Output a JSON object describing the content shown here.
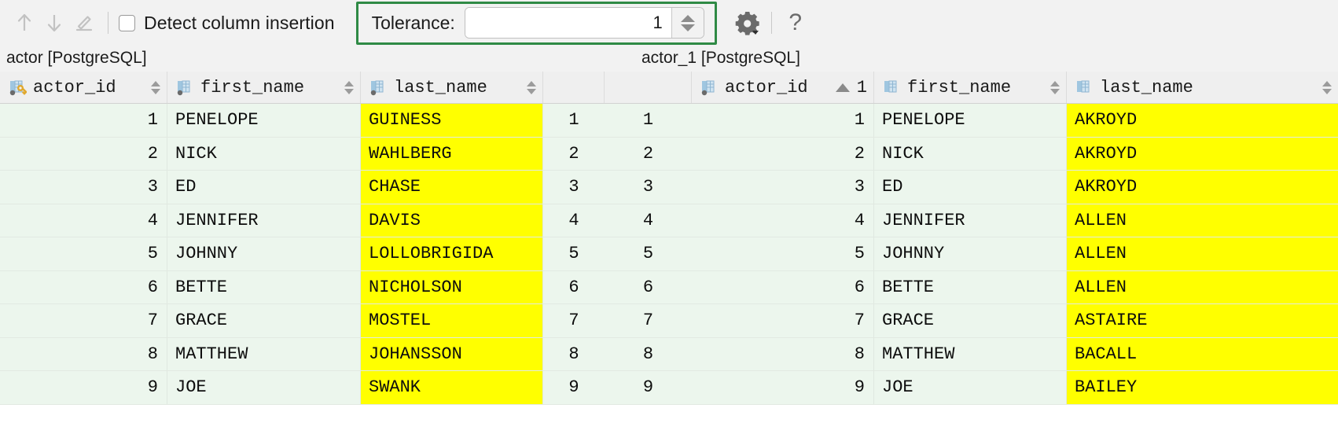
{
  "toolbar": {
    "icons": [
      {
        "name": "previous-difference-icon",
        "glyph": "up-arrow"
      },
      {
        "name": "next-difference-icon",
        "glyph": "down-arrow"
      },
      {
        "name": "edit-icon",
        "glyph": "pencil"
      }
    ],
    "detect_column_insertion_label": "Detect column insertion",
    "detect_column_insertion_checked": false,
    "tolerance_label": "Tolerance:",
    "tolerance_value": "1",
    "tolerance_placeholder": "",
    "settings_icon": "gear-icon",
    "help_icon": "question-mark-icon",
    "highlight_color": "#2f8a45"
  },
  "left_table": {
    "title": "actor [PostgreSQL]",
    "columns": [
      {
        "label": "actor_id",
        "icon": "primary-key-column-icon",
        "sortable": true
      },
      {
        "label": "first_name",
        "icon": "column-icon",
        "sortable": true
      },
      {
        "label": "last_name",
        "icon": "column-icon",
        "sortable": true
      }
    ],
    "rows": [
      {
        "actor_id": "1",
        "first_name": "PENELOPE",
        "last_name": "GUINESS"
      },
      {
        "actor_id": "2",
        "first_name": "NICK",
        "last_name": "WAHLBERG"
      },
      {
        "actor_id": "3",
        "first_name": "ED",
        "last_name": "CHASE"
      },
      {
        "actor_id": "4",
        "first_name": "JENNIFER",
        "last_name": "DAVIS"
      },
      {
        "actor_id": "5",
        "first_name": "JOHNNY",
        "last_name": "LOLLOBRIGIDA"
      },
      {
        "actor_id": "6",
        "first_name": "BETTE",
        "last_name": "NICHOLSON"
      },
      {
        "actor_id": "7",
        "first_name": "GRACE",
        "last_name": "MOSTEL"
      },
      {
        "actor_id": "8",
        "first_name": "MATTHEW",
        "last_name": "JOHANSSON"
      },
      {
        "actor_id": "9",
        "first_name": "JOE",
        "last_name": "SWANK"
      }
    ]
  },
  "gutter_left": {
    "values": [
      "1",
      "2",
      "3",
      "4",
      "5",
      "6",
      "7",
      "8",
      "9"
    ]
  },
  "gutter_right": {
    "values": [
      "1",
      "2",
      "3",
      "4",
      "5",
      "6",
      "7",
      "8",
      "9"
    ]
  },
  "right_table": {
    "title": "actor_1 [PostgreSQL]",
    "columns": [
      {
        "label": "actor_id",
        "icon": "column-icon",
        "sortable": true,
        "sort_direction": "asc",
        "sort_order": "1"
      },
      {
        "label": "first_name",
        "icon": "column-icon",
        "sortable": true
      },
      {
        "label": "last_name",
        "icon": "column-icon",
        "sortable": true
      }
    ],
    "rows": [
      {
        "actor_id": "1",
        "first_name": "PENELOPE",
        "last_name": "AKROYD"
      },
      {
        "actor_id": "2",
        "first_name": "NICK",
        "last_name": "AKROYD"
      },
      {
        "actor_id": "3",
        "first_name": "ED",
        "last_name": "AKROYD"
      },
      {
        "actor_id": "4",
        "first_name": "JENNIFER",
        "last_name": "ALLEN"
      },
      {
        "actor_id": "5",
        "first_name": "JOHNNY",
        "last_name": "ALLEN"
      },
      {
        "actor_id": "6",
        "first_name": "BETTE",
        "last_name": "ALLEN"
      },
      {
        "actor_id": "7",
        "first_name": "GRACE",
        "last_name": "ASTAIRE"
      },
      {
        "actor_id": "8",
        "first_name": "MATTHEW",
        "last_name": "BACALL"
      },
      {
        "actor_id": "9",
        "first_name": "JOE",
        "last_name": "BAILEY"
      }
    ]
  },
  "diff_highlight_color": "#ffff00",
  "row_background_color": "#ecf6ed"
}
